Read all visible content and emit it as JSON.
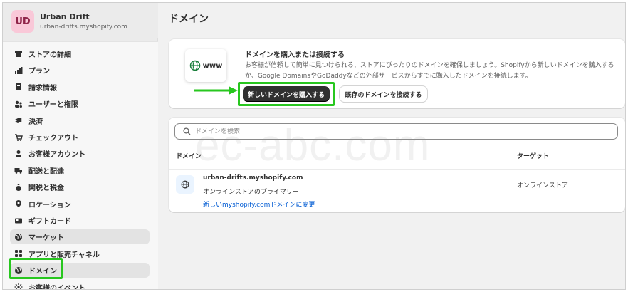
{
  "store": {
    "avatar_initials": "UD",
    "name": "Urban Drift",
    "domain": "urban-drifts.myshopify.com"
  },
  "sidebar": {
    "items": [
      {
        "label": "ストアの詳細",
        "icon": "store-icon"
      },
      {
        "label": "プラン",
        "icon": "plan-icon"
      },
      {
        "label": "請求情報",
        "icon": "billing-icon"
      },
      {
        "label": "ユーザーと権限",
        "icon": "users-icon"
      },
      {
        "label": "決済",
        "icon": "payments-icon"
      },
      {
        "label": "チェックアウト",
        "icon": "cart-icon"
      },
      {
        "label": "お客様アカウント",
        "icon": "person-icon"
      },
      {
        "label": "配送と配達",
        "icon": "truck-icon"
      },
      {
        "label": "関税と税金",
        "icon": "tax-icon"
      },
      {
        "label": "ロケーション",
        "icon": "location-icon"
      },
      {
        "label": "ギフトカード",
        "icon": "gift-card-icon"
      },
      {
        "label": "マーケット",
        "icon": "globe-icon"
      },
      {
        "label": "アプリと販売チャネル",
        "icon": "apps-icon"
      },
      {
        "label": "ドメイン",
        "icon": "domain-icon"
      },
      {
        "label": "お客様のイベント",
        "icon": "events-icon"
      }
    ],
    "active_index": 13
  },
  "page": {
    "title": "ドメイン"
  },
  "connect_card": {
    "illustration_text": "www",
    "title": "ドメインを購入または接続する",
    "description": "お客様が信頼して簡単に見つけられる、ストアにぴったりのドメインを確保しましょう。Shopifyから新しいドメインを購入するか、Google DomainsやGoDaddyなどの外部サービスからすでに購入したドメインを接続します。",
    "buy_button": "新しいドメインを購入する",
    "connect_button": "既存のドメインを接続する"
  },
  "domains": {
    "search_placeholder": "ドメインを検索",
    "col_domain": "ドメイン",
    "col_target": "ターゲット",
    "rows": [
      {
        "name": "urban-drifts.myshopify.com",
        "subtitle": "オンラインストアのプライマリー",
        "link": "新しいmyshopify.comドメインに変更",
        "target": "オンラインストア"
      }
    ]
  },
  "watermark": "ec-abc.com",
  "colors": {
    "highlight": "#28c71f",
    "primary_button": "#303030",
    "link": "#005bd3",
    "avatar_bg": "#f9c8d8"
  }
}
